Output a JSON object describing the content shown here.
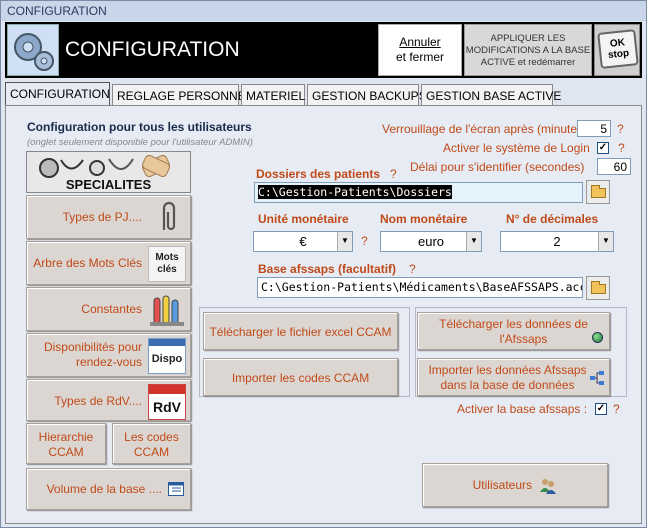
{
  "window": {
    "title": "CONFIGURATION"
  },
  "header": {
    "title": "CONFIGURATION",
    "annuler_line1": "Annuler",
    "annuler_line2": "et fermer",
    "apply_line1": "APPLIQUER LES",
    "apply_line2": "MODIFICATIONS  A LA BASE",
    "apply_line3": "ACTIVE et redémarrer",
    "ok_label": "OK",
    "stop_label": "stop"
  },
  "tabs": [
    {
      "label": "CONFIGURATION"
    },
    {
      "label": "REGLAGE PERSONNEL"
    },
    {
      "label": "MATERIEL"
    },
    {
      "label": "GESTION BACKUPS"
    },
    {
      "label": "GESTION BASE ACTIVE"
    }
  ],
  "left": {
    "heading": "Configuration pour tous les utilisateurs",
    "subheading": "(onglet seulement disponible pour l'utilisateur ADMIN)",
    "specialites": "SPECIALITES",
    "buttons": {
      "types_pj": "Types de PJ....",
      "arbre_mots": "Arbre des Mots Clés",
      "mots_cles_icon_line1": "Mots",
      "mots_cles_icon_line2": "clés",
      "constantes": "Constantes",
      "dispo_line1": "Disponibilités pour",
      "dispo_line2": "rendez-vous",
      "dispo_icon": "Dispo",
      "types_rdv": "Types de RdV....",
      "rdv_icon": "RdV",
      "hierarchie_line1": "Hierarchie",
      "hierarchie_line2": "CCAM",
      "codes_line1": "Les codes",
      "codes_line2": "CCAM",
      "volume": "Volume de la base ...."
    }
  },
  "right": {
    "verrouillage_label": "Verrouillage de l'écran après (minutes)",
    "verrouillage_value": "5",
    "login_label": "Activer le système de Login",
    "login_checked": "✓",
    "delai_label": "Délai pour s'identifier (secondes)",
    "delai_value": "60",
    "dossiers_label": "Dossiers des patients",
    "dossiers_value": "C:\\Gestion-Patients\\Dossiers",
    "unite_label": "Unité monétaire",
    "unite_value": "€",
    "nom_label": "Nom monétaire",
    "nom_value": "euro",
    "decimales_label": "N° de décimales",
    "decimales_value": "2",
    "base_label": "Base afssaps (facultatif)",
    "base_value": "C:\\Gestion-Patients\\Médicaments\\BaseAFSSAPS.acc",
    "telecharger_ccam": "Télécharger le fichier excel CCAM",
    "importer_ccam": "Importer les codes CCAM",
    "telecharger_afssaps_line1": "Télécharger les données de",
    "telecharger_afssaps_line2": "l'Afssaps",
    "importer_afssaps_line1": "Importer les données Afssaps",
    "importer_afssaps_line2": "dans la base de données",
    "activer_afssaps_label": "Activer la base afssaps :",
    "activer_afssaps_checked": "✓",
    "utilisateurs": "Utilisateurs",
    "question_mark": "?",
    "dropdown_arrow": "▼"
  }
}
